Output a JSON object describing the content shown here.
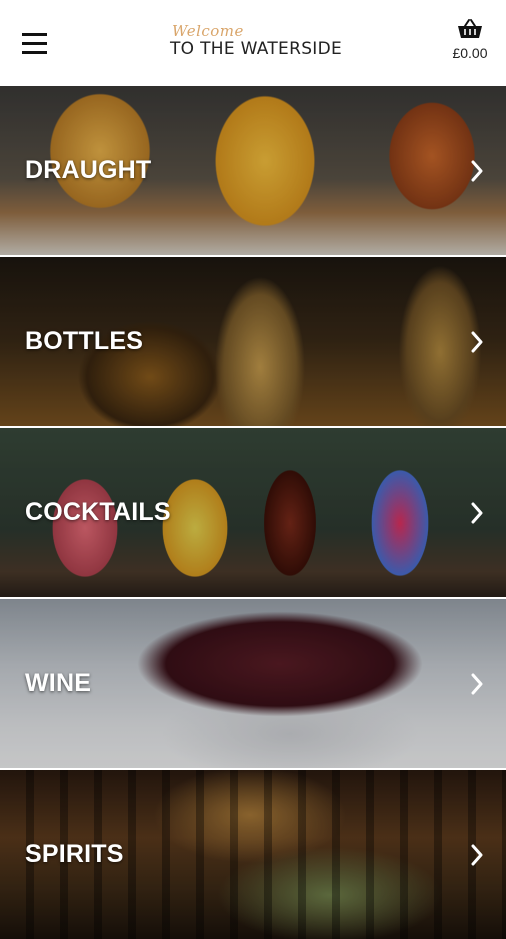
{
  "header": {
    "logo_script": "Welcome",
    "logo_main": "TO THE WATERSIDE",
    "basket_total": "£0.00"
  },
  "categories": [
    {
      "label": "DRAUGHT"
    },
    {
      "label": "BOTTLES"
    },
    {
      "label": "COCKTAILS"
    },
    {
      "label": "WINE"
    },
    {
      "label": "SPIRITS"
    }
  ],
  "icons": {
    "menu": "hamburger-menu-icon",
    "basket": "basket-icon",
    "chevron": "chevron-right-icon"
  },
  "colors": {
    "header_bg": "#ffffff",
    "logo_script": "#d9a56a",
    "label_text": "#ffffff"
  }
}
